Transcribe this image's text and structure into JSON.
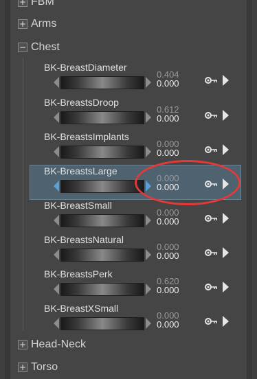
{
  "groups": {
    "top_partial": "FBM",
    "arms": "Arms",
    "chest": "Chest",
    "head_neck": "Head-Neck",
    "torso": "Torso"
  },
  "expand_symbols": {
    "collapsed": "+",
    "expanded": "−"
  },
  "morphs": [
    {
      "name": "BK-BreastDiameter",
      "value": "0.404",
      "default": "0.000"
    },
    {
      "name": "BK-BreastsDroop",
      "value": "0.612",
      "default": "0.000"
    },
    {
      "name": "BK-BreastsImplants",
      "value": "0.000",
      "default": "0.000"
    },
    {
      "name": "BK-BreastsLarge",
      "value": "0.000",
      "default": "0.000",
      "selected": true
    },
    {
      "name": "BK-BreastSmall",
      "value": "0.000",
      "default": "0.000"
    },
    {
      "name": "BK-BreastsNatural",
      "value": "0.000",
      "default": "0.000"
    },
    {
      "name": "BK-BreastsPerk",
      "value": "0.620",
      "default": "0.000"
    },
    {
      "name": "BK-BreastXSmall",
      "value": "0.000",
      "default": "0.000"
    }
  ],
  "icons": {
    "key": "key-icon",
    "play": "play-arrow-icon"
  },
  "colors": {
    "selection": "#4e6270",
    "annotation": "#e23a3a",
    "arrow_selected": "#5aa0d6"
  }
}
